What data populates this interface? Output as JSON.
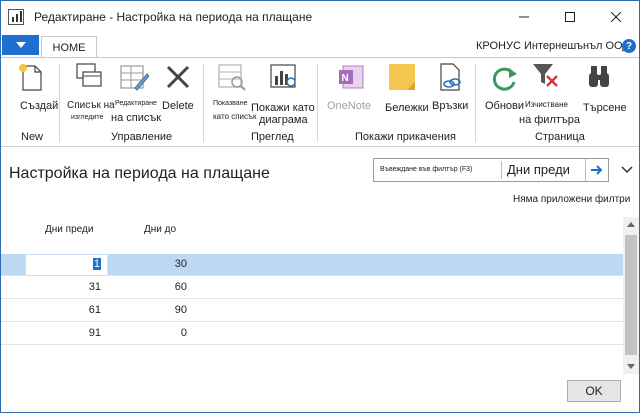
{
  "window": {
    "title": "Редактиране - Настройка на периода на плащане",
    "minimize_icon": "minimize-icon",
    "maximize_icon": "maximize-icon",
    "close_icon": "close-icon"
  },
  "tabs": {
    "quick_access_icon": "dropdown-arrow-icon",
    "home": "HOME",
    "company": "КРОНУС Интернешънъл ООД",
    "help_icon": "?"
  },
  "ribbon": {
    "groups": {
      "new": "New",
      "manage": "Управление",
      "view": "Преглед",
      "attachments": "Покажи прикачения",
      "page": "Страница"
    },
    "buttons": {
      "create": "Създай",
      "list_view_l1": "Списък на",
      "list_view_l2": "изгледите",
      "edit_list_l1": "Редактиране",
      "edit_list_l2": "на списък",
      "delete": "Delete",
      "show_as_list_l1": "Показване",
      "show_as_list_l2": "като списък",
      "show_as_chart_l1": "Покажи като",
      "show_as_chart_l2": "диаграма",
      "onenote": "OneNote",
      "notes": "Бележки",
      "links": "Връзки",
      "refresh": "Обнови",
      "clear_filter_l1": "Изчистване",
      "clear_filter_l2": "на филтъра",
      "search": "Търсене"
    }
  },
  "page": {
    "title": "Настройка на периода на плащане",
    "filter_placeholder": "Въвеждане във филтър (F3)",
    "filter_field": "Дни преди",
    "no_filters": "Няма приложени филтри"
  },
  "table": {
    "columns": [
      "Дни преди",
      "Дни до"
    ],
    "rows": [
      [
        "1",
        "30"
      ],
      [
        "31",
        "60"
      ],
      [
        "61",
        "90"
      ],
      [
        "91",
        "0"
      ]
    ],
    "selected_row": 0
  },
  "footer": {
    "ok": "OK"
  },
  "colors": {
    "accent": "#1e6fd0",
    "selection": "#bcd8f3"
  }
}
